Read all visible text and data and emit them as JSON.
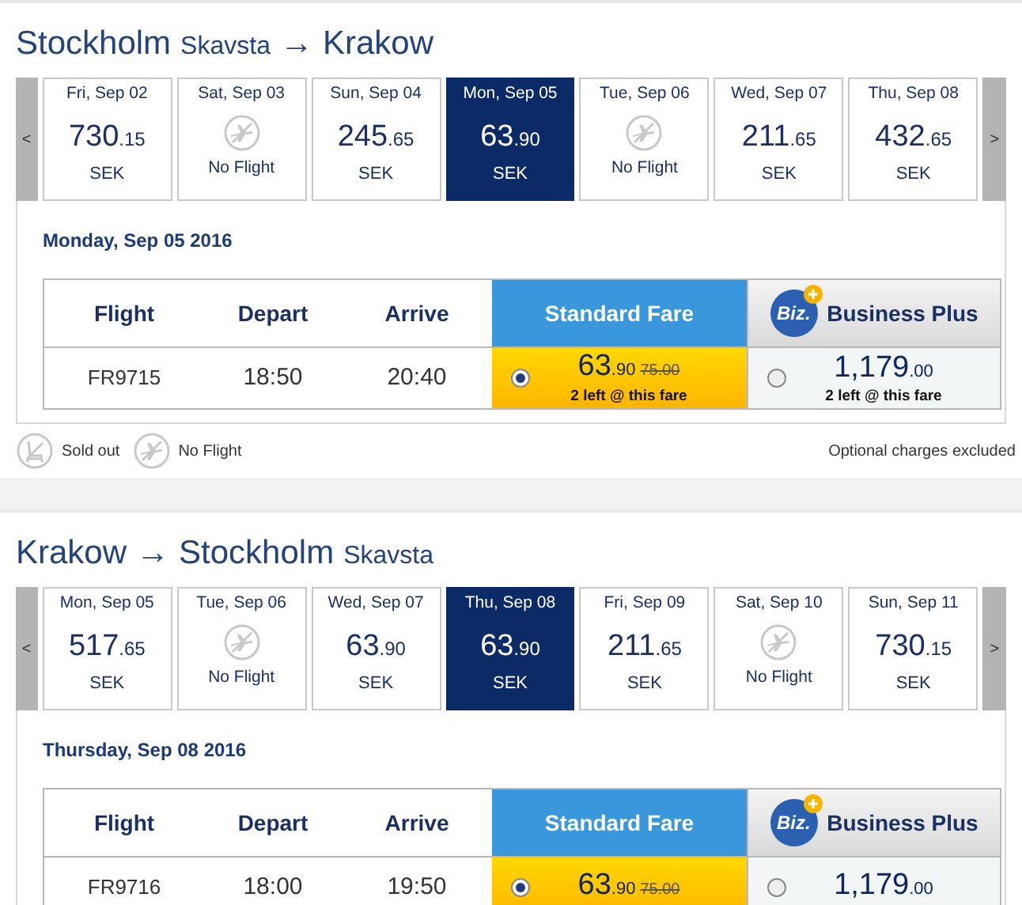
{
  "sections": [
    {
      "title": {
        "from": "Stockholm",
        "from_sub": "Skavsta",
        "arrow": "→",
        "to": "Krakow"
      },
      "prev": "<",
      "next": ">",
      "days": [
        {
          "kind": "fare",
          "date": "Fri, Sep 02",
          "price": "730",
          "cents": ".15",
          "currency": "SEK",
          "selected": false
        },
        {
          "kind": "no_flight",
          "date": "Sat, Sep 03",
          "note": "No Flight",
          "selected": false
        },
        {
          "kind": "fare",
          "date": "Sun, Sep 04",
          "price": "245",
          "cents": ".65",
          "currency": "SEK",
          "selected": false
        },
        {
          "kind": "fare",
          "date": "Mon, Sep 05",
          "price": "63",
          "cents": ".90",
          "currency": "SEK",
          "selected": true
        },
        {
          "kind": "no_flight",
          "date": "Tue, Sep 06",
          "note": "No Flight",
          "selected": false
        },
        {
          "kind": "fare",
          "date": "Wed, Sep 07",
          "price": "211",
          "cents": ".65",
          "currency": "SEK",
          "selected": false
        },
        {
          "kind": "fare",
          "date": "Thu, Sep 08",
          "price": "432",
          "cents": ".65",
          "currency": "SEK",
          "selected": false
        }
      ],
      "heading": "Monday, Sep 05 2016",
      "columns": [
        "Flight",
        "Depart",
        "Arrive"
      ],
      "standard_label": "Standard Fare",
      "business_logo": "Biz.",
      "business_label": "Business Plus",
      "flight": {
        "number": "FR9715",
        "depart": "18:50",
        "arrive": "20:40",
        "standard": {
          "price": "63",
          "cents": ".90",
          "old_price": "75.00",
          "note": "2 left @ this fare",
          "selected": true
        },
        "business": {
          "price": "1,179",
          "cents": ".00",
          "note": "2 left @ this fare",
          "selected": false
        }
      },
      "legend": {
        "sold_out": "Sold out",
        "no_flight": "No Flight",
        "charges": "Optional charges excluded"
      }
    },
    {
      "title": {
        "from": "Krakow",
        "arrow": "→",
        "to": "Stockholm",
        "to_sub": "Skavsta"
      },
      "prev": "<",
      "next": ">",
      "days": [
        {
          "kind": "fare",
          "date": "Mon, Sep 05",
          "price": "517",
          "cents": ".65",
          "currency": "SEK",
          "selected": false
        },
        {
          "kind": "no_flight",
          "date": "Tue, Sep 06",
          "note": "No Flight",
          "selected": false
        },
        {
          "kind": "fare",
          "date": "Wed, Sep 07",
          "price": "63",
          "cents": ".90",
          "currency": "SEK",
          "selected": false
        },
        {
          "kind": "fare",
          "date": "Thu, Sep 08",
          "price": "63",
          "cents": ".90",
          "currency": "SEK",
          "selected": true
        },
        {
          "kind": "fare",
          "date": "Fri, Sep 09",
          "price": "211",
          "cents": ".65",
          "currency": "SEK",
          "selected": false
        },
        {
          "kind": "no_flight",
          "date": "Sat, Sep 10",
          "note": "No Flight",
          "selected": false
        },
        {
          "kind": "fare",
          "date": "Sun, Sep 11",
          "price": "730",
          "cents": ".15",
          "currency": "SEK",
          "selected": false
        }
      ],
      "heading": "Thursday, Sep 08 2016",
      "columns": [
        "Flight",
        "Depart",
        "Arrive"
      ],
      "standard_label": "Standard Fare",
      "business_logo": "Biz.",
      "business_label": "Business Plus",
      "flight": {
        "number": "FR9716",
        "depart": "18:00",
        "arrive": "19:50",
        "standard": {
          "price": "63",
          "cents": ".90",
          "old_price": "75.00",
          "selected": true
        },
        "business": {
          "price": "1,179",
          "cents": ".00",
          "selected": false
        }
      }
    }
  ]
}
